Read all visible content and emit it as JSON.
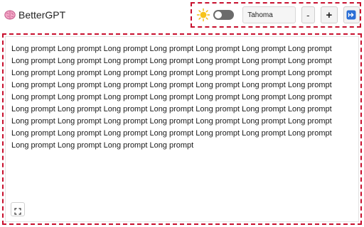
{
  "header": {
    "title": "BetterGPT",
    "brand_icon": "brain-icon"
  },
  "controls": {
    "theme_icon": "sun-icon",
    "theme_toggle_on": false,
    "font_family_value": "Tahoma",
    "decrease_label": "-",
    "increase_label": "+",
    "action_icon": "submit-icon"
  },
  "editor": {
    "text": "Long prompt Long prompt Long prompt Long prompt Long prompt Long prompt Long prompt Long prompt Long prompt Long prompt Long prompt Long prompt Long prompt Long prompt Long prompt Long prompt Long prompt Long prompt Long prompt Long prompt Long prompt Long prompt Long prompt Long prompt Long prompt Long prompt Long prompt Long prompt Long prompt Long prompt Long prompt Long prompt Long prompt Long prompt Long prompt Long prompt Long prompt Long prompt Long prompt Long prompt Long prompt Long prompt Long prompt Long prompt Long prompt Long prompt Long prompt Long prompt Long prompt Long prompt Long prompt Long prompt Long prompt Long prompt Long prompt Long prompt Long prompt Long prompt Long prompt Long prompt",
    "expand_icon": "expand-icon"
  },
  "colors": {
    "highlight_border": "#c8102e",
    "toggle_track": "#6b6b6b",
    "action_accent": "#2a6fd6"
  }
}
